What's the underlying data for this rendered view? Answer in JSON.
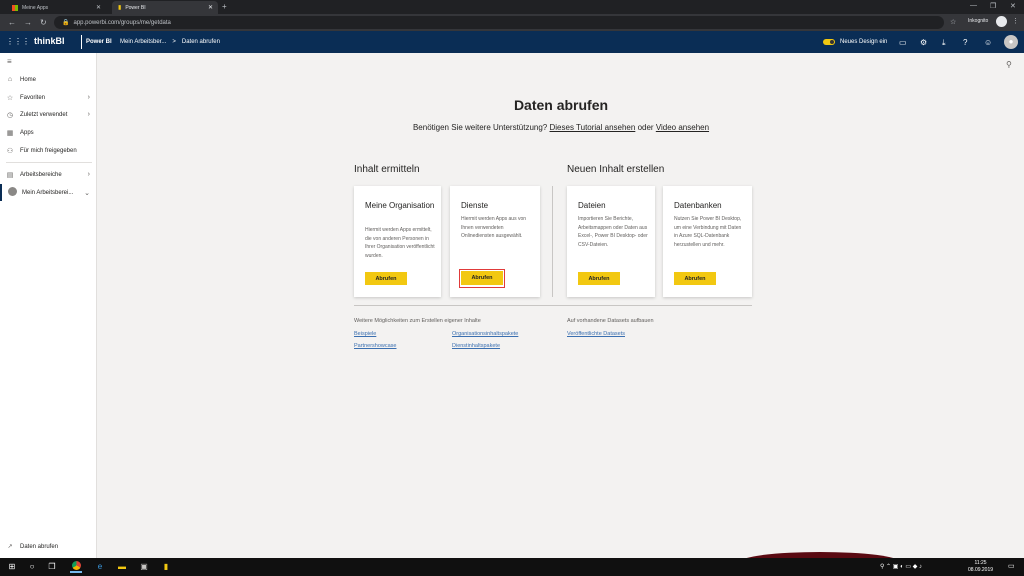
{
  "browser": {
    "tabs": [
      {
        "label": "Meine Apps"
      },
      {
        "label": "Power BI"
      }
    ],
    "new_tab": "+",
    "url": "app.powerbi.com/groups/me/getdata",
    "incognito": "Inkognito"
  },
  "header": {
    "brand": "thinkBI",
    "product": "Power BI",
    "breadcrumb": [
      "Mein Arbeitsber...",
      ">",
      "Daten abrufen"
    ],
    "new_design": "Neues Design ein"
  },
  "sidebar": {
    "items": [
      {
        "label": "Home",
        "icon": "home-icon"
      },
      {
        "label": "Favoriten",
        "icon": "star-icon"
      },
      {
        "label": "Zuletzt verwendet",
        "icon": "clock-icon"
      },
      {
        "label": "Apps",
        "icon": "apps-icon"
      },
      {
        "label": "Für mich freigegeben",
        "icon": "share-icon"
      },
      {
        "label": "Arbeitsbereiche",
        "icon": "workspaces-icon"
      },
      {
        "label": "Mein Arbeitsberei...",
        "icon": "workspace-icon"
      }
    ],
    "footer": "Daten abrufen"
  },
  "main": {
    "title": "Daten abrufen",
    "subtitle_pre": "Benötigen Sie weitere Unterstützung?",
    "tutorial_link": "Dieses Tutorial ansehen",
    "subtitle_or": "oder",
    "video_link": "Video ansehen",
    "discover_heading": "Inhalt ermitteln",
    "create_heading": "Neuen Inhalt erstellen",
    "cards": [
      {
        "title": "Meine Organisation",
        "desc": "Hiermit werden Apps ermittelt, die von anderen Personen in Ihrer Organisation veröffentlicht wurden.",
        "button": "Abrufen"
      },
      {
        "title": "Dienste",
        "desc": "Hiermit werden Apps aus von Ihnen verwendeten Onlinediensten ausgewählt.",
        "button": "Abrufen"
      },
      {
        "title": "Dateien",
        "desc": "Importieren Sie Berichte, Arbeitsmappen oder Daten aus Excel-, Power BI Desktop- oder CSV-Dateien.",
        "button": "Abrufen"
      },
      {
        "title": "Datenbanken",
        "desc": "Nutzen Sie Power BI Desktop, um eine Verbindung mit Daten in Azure SQL-Datenbank herzustellen und mehr.",
        "button": "Abrufen"
      }
    ],
    "more_heading": "Weitere Möglichkeiten zum Erstellen eigener Inhalte",
    "more_links": [
      "Beispiele",
      "Organisationsinhaltspakete",
      "Partnershowcase",
      "Dienstinhaltspakete"
    ],
    "datasets_heading": "Auf vorhandene Datasets aufbauen",
    "datasets_link": "Veröffentlichte Datasets"
  },
  "taskbar": {
    "time": "11:25",
    "date": "08.09.2019"
  }
}
